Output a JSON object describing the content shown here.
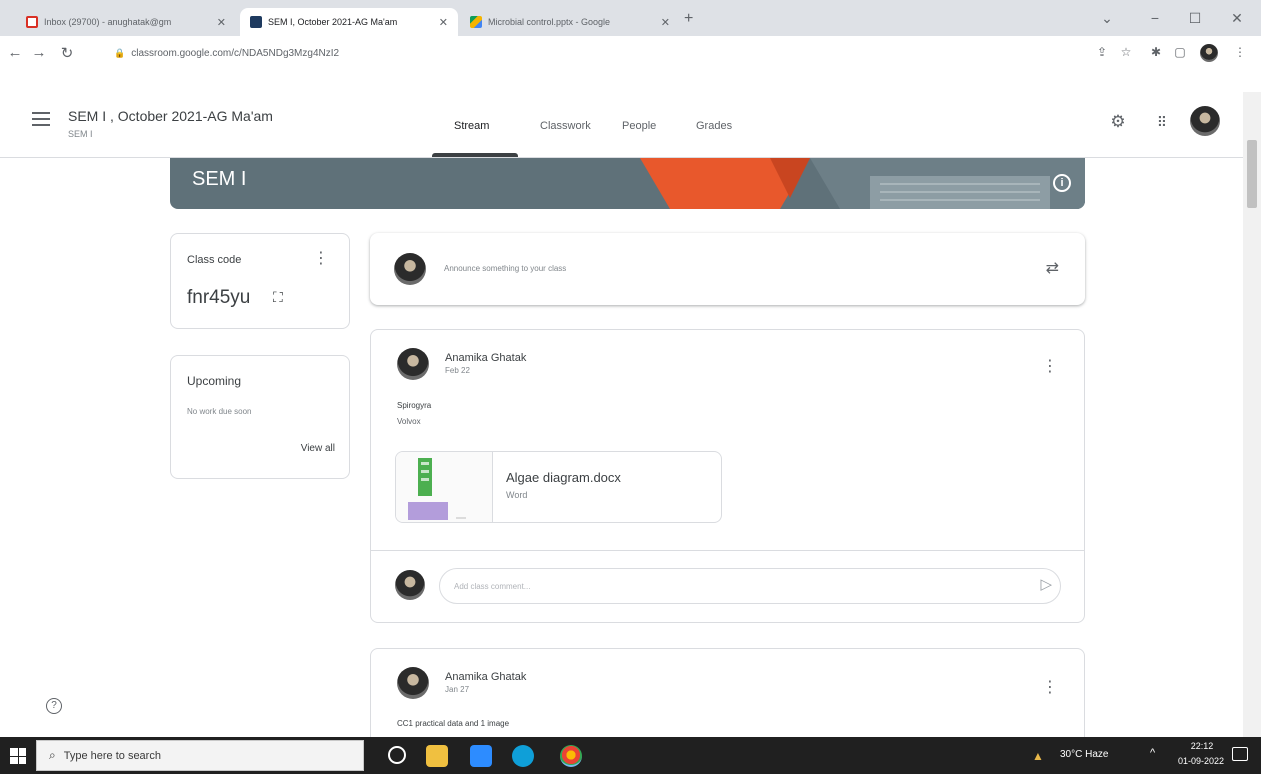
{
  "browser": {
    "tabs": [
      {
        "title": "Inbox (29700) - anughatak@gm",
        "favicon": "gmail-icon",
        "color": "#d93025"
      },
      {
        "title": "SEM I, October 2021-AG Ma'am",
        "favicon": "classroom-icon",
        "color": "#1e3a5f"
      },
      {
        "title": "Microbial control.pptx - Google",
        "favicon": "drive-icon",
        "color": "#0f9d58"
      }
    ],
    "new_tab": "+",
    "url": "classroom.google.com/c/NDA5NDg3Mzg4NzI2",
    "window_controls": {
      "minimize": "−",
      "maximize": "☐",
      "close": "✕",
      "dropdown": "⌄"
    }
  },
  "header": {
    "title": "SEM I , October 2021-AG Ma'am",
    "subtitle": "SEM I",
    "tabs": [
      "Stream",
      "Classwork",
      "People",
      "Grades"
    ],
    "active_tab": "Stream"
  },
  "banner": {
    "title": "SEM I",
    "color": "#5f7179"
  },
  "class_code": {
    "label": "Class code",
    "value": "fnr45yu"
  },
  "upcoming": {
    "title": "Upcoming",
    "text": "No work due soon",
    "link": "View all"
  },
  "announce": {
    "placeholder": "Announce something to your class"
  },
  "posts": [
    {
      "author": "Anamika Ghatak",
      "date": "Feb 22",
      "lines": [
        "Spirogyra",
        "Volvox"
      ],
      "attachment": {
        "name": "Algae diagram.docx",
        "type": "Word"
      },
      "comment_placeholder": "Add class comment..."
    },
    {
      "author": "Anamika Ghatak",
      "date": "Jan 27",
      "lines": [
        "CC1 practical data and 1 image"
      ]
    }
  ],
  "taskbar": {
    "search_placeholder": "Type here to search",
    "weather": "30°C Haze",
    "time": "22:12",
    "date": "01-09-2022"
  }
}
